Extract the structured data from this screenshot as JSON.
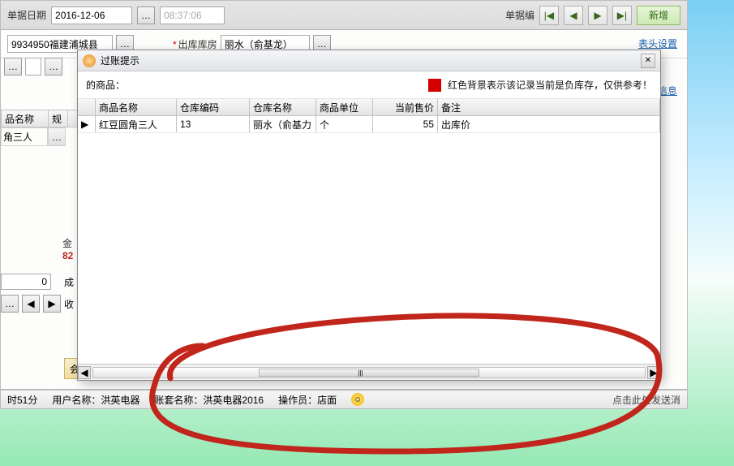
{
  "toolbar": {
    "date_label": "单据日期",
    "date_value": "2016-12-06",
    "time_value": "08:37:06",
    "docno_label": "单据编",
    "new_label": "新增"
  },
  "row2": {
    "left_value": "9934950福建浦城县",
    "warehouse_label": "出库库房",
    "warehouse_value": "丽水（俞基龙）",
    "header_setting": "表头设置",
    "info": "信息"
  },
  "backgrid": {
    "col1": "品名称",
    "col2": "规",
    "cell1": "角三人"
  },
  "amounts": {
    "amt_label": "金",
    "amt_value": "82"
  },
  "zero_value": "0",
  "side": {
    "cheng": "成",
    "shou": "收"
  },
  "member_btn": "会",
  "dialog": {
    "title": "过账提示",
    "lead": "的商品：",
    "notice": "红色背景表示该记录当前是负库存，仅供参考！",
    "headers": {
      "pname": "商品名称",
      "wcode": "仓库编码",
      "wname": "仓库名称",
      "unit": "商品单位",
      "price": "当前售价",
      "remark": "备注"
    },
    "row": {
      "pname": "红豆圆角三人",
      "wcode": "13",
      "wname": "丽水（俞基力",
      "unit": "个",
      "price": "55",
      "remark": "出库价"
    }
  },
  "status": {
    "time": "时51分",
    "user_label": "用户名称：",
    "user_value": "洪英电器",
    "account_label": "账套名称：",
    "account_value": "洪英电器2016",
    "operator_label": "操作员：",
    "operator_value": "店面",
    "send": "点击此处发送消"
  }
}
